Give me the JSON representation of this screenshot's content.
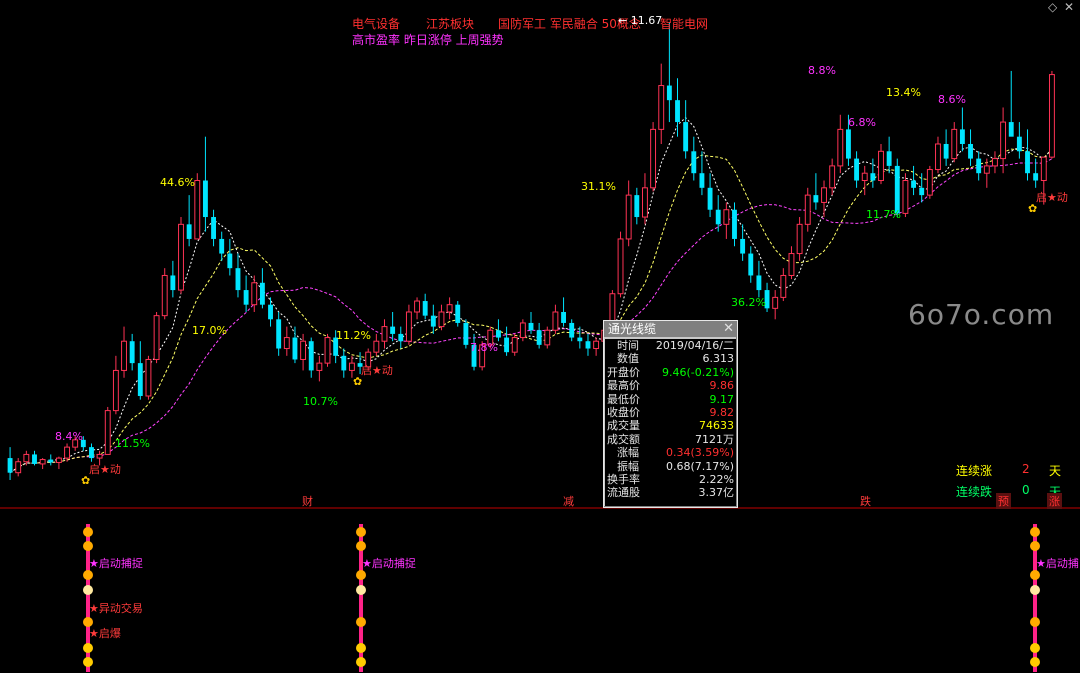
{
  "header": {
    "row1": [
      {
        "text": "电气设备",
        "color": "#ff3030"
      },
      {
        "text": "江苏板块",
        "color": "#ff3030"
      },
      {
        "text": "国防军工 军民融合 50概念",
        "color": "#ff3030"
      },
      {
        "text": "智能电网",
        "color": "#ff3030"
      }
    ],
    "row2": {
      "text": "高市盈率 昨日涨停 上周强势",
      "color": "#ff33ff"
    },
    "peak_price": "11.67"
  },
  "pct_labels": [
    {
      "text": "44.6%",
      "color": "#ffff00"
    },
    {
      "text": "17.0%",
      "color": "#ffff00"
    },
    {
      "text": "11.5%",
      "color": "#00ff00"
    },
    {
      "text": "8.4%",
      "color": "#ff33ff"
    },
    {
      "text": "10.7%",
      "color": "#00ff00"
    },
    {
      "text": "11.2%",
      "color": "#ffff00"
    },
    {
      "text": "7.8%",
      "color": "#ff33ff"
    },
    {
      "text": "31.1%",
      "color": "#ffff00"
    },
    {
      "text": "36.2%",
      "color": "#00ff00"
    },
    {
      "text": "8.8%",
      "color": "#ff33ff"
    },
    {
      "text": "6.8%",
      "color": "#ff33ff"
    },
    {
      "text": "11.7%",
      "color": "#00ff00"
    },
    {
      "text": "13.4%",
      "color": "#ffff00"
    },
    {
      "text": "8.6%",
      "color": "#ff33ff"
    }
  ],
  "start_labels": [
    "启★动",
    "启★动",
    "启★动"
  ],
  "axis_marks": [
    {
      "text": "财",
      "color": "#66aaff"
    },
    {
      "text": "减",
      "color": "#00ff66"
    },
    {
      "text": "跌",
      "color": "#00ff66"
    }
  ],
  "tooltip": {
    "title": "通光线缆",
    "close": "✕",
    "rows": [
      {
        "label": "时间",
        "value": "2019/04/16/二",
        "color": "#e6e6e6"
      },
      {
        "label": "数值",
        "value": "6.313",
        "color": "#e6e6e6"
      },
      {
        "label": "开盘价",
        "value": "9.46(-0.21%)",
        "color": "#00ff00"
      },
      {
        "label": "最高价",
        "value": "9.86",
        "color": "#ff3030"
      },
      {
        "label": "最低价",
        "value": "9.17",
        "color": "#00ff00"
      },
      {
        "label": "收盘价",
        "value": "9.82",
        "color": "#ff3030"
      },
      {
        "label": "成交量",
        "value": "74633",
        "color": "#ffff00"
      },
      {
        "label": "成交额",
        "value": "7121万",
        "color": "#e6e6e6"
      },
      {
        "label": "涨幅",
        "value": "0.34(3.59%)",
        "color": "#ff3030"
      },
      {
        "label": "振幅",
        "value": "0.68(7.17%)",
        "color": "#e6e6e6"
      },
      {
        "label": "换手率",
        "value": "2.22%",
        "color": "#e6e6e6"
      },
      {
        "label": "流通股",
        "value": "3.37亿",
        "color": "#e6e6e6"
      }
    ]
  },
  "streaks": {
    "up": {
      "label": "连续涨",
      "count": "2",
      "unit": "天"
    },
    "down": {
      "label": "连续跌",
      "count": "0",
      "unit": "天"
    },
    "pre": "预",
    "rise": "涨"
  },
  "signals": {
    "catch": "★启动捕捉",
    "catch_cut": "★启动捕",
    "abnormal": "★异动交易",
    "launch": "★启爆"
  },
  "watermark": "6o7o.com",
  "colors": {
    "up": "#ff3355",
    "down": "#00e5ff",
    "ma_fast": "#ffffff",
    "ma_mid": "#ffff66",
    "ma_slow": "#ff44ff",
    "divider": "#c00000",
    "signal_bar": "#ff2288"
  },
  "chart_data": {
    "type": "candlestick",
    "ohlc": [
      [
        5.7,
        5.85,
        5.4,
        5.5
      ],
      [
        5.5,
        5.7,
        5.45,
        5.65
      ],
      [
        5.65,
        5.8,
        5.6,
        5.75
      ],
      [
        5.75,
        5.8,
        5.6,
        5.62
      ],
      [
        5.62,
        5.7,
        5.55,
        5.68
      ],
      [
        5.68,
        5.75,
        5.6,
        5.64
      ],
      [
        5.64,
        5.72,
        5.55,
        5.7
      ],
      [
        5.7,
        5.9,
        5.65,
        5.85
      ],
      [
        5.85,
        6.0,
        5.8,
        5.95
      ],
      [
        5.95,
        6.0,
        5.8,
        5.85
      ],
      [
        5.85,
        5.9,
        5.65,
        5.7
      ],
      [
        5.7,
        5.8,
        5.6,
        5.75
      ],
      [
        5.75,
        6.4,
        5.75,
        6.35
      ],
      [
        6.35,
        7.1,
        6.3,
        6.9
      ],
      [
        6.9,
        7.5,
        6.8,
        7.3
      ],
      [
        7.3,
        7.4,
        6.9,
        7.0
      ],
      [
        7.0,
        7.3,
        6.5,
        6.55
      ],
      [
        6.55,
        7.1,
        6.5,
        7.05
      ],
      [
        7.05,
        7.7,
        7.0,
        7.65
      ],
      [
        7.65,
        8.3,
        7.6,
        8.2
      ],
      [
        8.2,
        8.4,
        7.9,
        8.0
      ],
      [
        8.0,
        9.0,
        7.95,
        8.9
      ],
      [
        8.9,
        9.3,
        8.6,
        8.7
      ],
      [
        8.7,
        9.6,
        8.7,
        9.5
      ],
      [
        9.5,
        10.1,
        8.8,
        9.0
      ],
      [
        9.0,
        9.1,
        8.6,
        8.7
      ],
      [
        8.7,
        8.8,
        8.4,
        8.5
      ],
      [
        8.5,
        8.7,
        8.2,
        8.3
      ],
      [
        8.3,
        8.5,
        7.9,
        8.0
      ],
      [
        8.0,
        8.2,
        7.7,
        7.8
      ],
      [
        7.8,
        8.2,
        7.7,
        8.1
      ],
      [
        8.1,
        8.3,
        7.75,
        7.8
      ],
      [
        7.8,
        7.9,
        7.5,
        7.6
      ],
      [
        7.6,
        7.7,
        7.1,
        7.2
      ],
      [
        7.2,
        7.5,
        7.1,
        7.35
      ],
      [
        7.35,
        7.5,
        7.0,
        7.05
      ],
      [
        7.05,
        7.4,
        6.9,
        7.3
      ],
      [
        7.3,
        7.35,
        6.8,
        6.9
      ],
      [
        6.9,
        7.1,
        6.75,
        7.0
      ],
      [
        7.0,
        7.4,
        6.95,
        7.35
      ],
      [
        7.35,
        7.45,
        7.0,
        7.1
      ],
      [
        7.1,
        7.2,
        6.8,
        6.9
      ],
      [
        6.9,
        7.1,
        6.8,
        7.0
      ],
      [
        7.0,
        7.15,
        6.85,
        6.95
      ],
      [
        6.95,
        7.2,
        6.9,
        7.15
      ],
      [
        7.15,
        7.4,
        7.1,
        7.3
      ],
      [
        7.3,
        7.6,
        7.2,
        7.5
      ],
      [
        7.5,
        7.7,
        7.3,
        7.4
      ],
      [
        7.4,
        7.5,
        7.2,
        7.3
      ],
      [
        7.3,
        7.8,
        7.25,
        7.7
      ],
      [
        7.7,
        7.9,
        7.6,
        7.85
      ],
      [
        7.85,
        7.95,
        7.6,
        7.65
      ],
      [
        7.65,
        7.8,
        7.4,
        7.5
      ],
      [
        7.5,
        7.8,
        7.45,
        7.7
      ],
      [
        7.7,
        7.9,
        7.6,
        7.8
      ],
      [
        7.8,
        7.85,
        7.5,
        7.55
      ],
      [
        7.55,
        7.6,
        7.2,
        7.25
      ],
      [
        7.25,
        7.4,
        6.9,
        6.95
      ],
      [
        6.95,
        7.3,
        6.9,
        7.25
      ],
      [
        7.25,
        7.5,
        7.2,
        7.45
      ],
      [
        7.45,
        7.6,
        7.3,
        7.35
      ],
      [
        7.35,
        7.5,
        7.1,
        7.15
      ],
      [
        7.15,
        7.4,
        7.1,
        7.35
      ],
      [
        7.35,
        7.6,
        7.3,
        7.55
      ],
      [
        7.55,
        7.7,
        7.4,
        7.45
      ],
      [
        7.45,
        7.55,
        7.2,
        7.25
      ],
      [
        7.25,
        7.5,
        7.2,
        7.45
      ],
      [
        7.45,
        7.8,
        7.4,
        7.7
      ],
      [
        7.7,
        7.9,
        7.5,
        7.55
      ],
      [
        7.55,
        7.6,
        7.3,
        7.35
      ],
      [
        7.35,
        7.5,
        7.2,
        7.3
      ],
      [
        7.3,
        7.4,
        7.1,
        7.2
      ],
      [
        7.2,
        7.35,
        7.1,
        7.3
      ],
      [
        7.3,
        7.5,
        7.25,
        7.45
      ],
      [
        7.45,
        8.0,
        7.45,
        7.95
      ],
      [
        7.95,
        8.8,
        7.9,
        8.7
      ],
      [
        8.7,
        9.5,
        8.6,
        9.3
      ],
      [
        9.3,
        9.4,
        8.9,
        9.0
      ],
      [
        9.0,
        9.6,
        8.9,
        9.4
      ],
      [
        9.4,
        10.3,
        9.35,
        10.2
      ],
      [
        10.2,
        11.1,
        10.0,
        10.8
      ],
      [
        10.8,
        11.67,
        10.3,
        10.6
      ],
      [
        10.6,
        10.9,
        10.1,
        10.3
      ],
      [
        10.3,
        10.6,
        9.8,
        9.9
      ],
      [
        9.9,
        10.1,
        9.5,
        9.6
      ],
      [
        9.6,
        9.9,
        9.3,
        9.4
      ],
      [
        9.4,
        9.6,
        9.0,
        9.1
      ],
      [
        9.1,
        9.3,
        8.8,
        8.9
      ],
      [
        8.9,
        9.2,
        8.7,
        9.1
      ],
      [
        9.1,
        9.2,
        8.6,
        8.7
      ],
      [
        8.7,
        8.9,
        8.4,
        8.5
      ],
      [
        8.5,
        8.6,
        8.1,
        8.2
      ],
      [
        8.2,
        8.4,
        7.9,
        8.0
      ],
      [
        8.0,
        8.1,
        7.7,
        7.75
      ],
      [
        7.75,
        8.0,
        7.6,
        7.9
      ],
      [
        7.9,
        8.3,
        7.85,
        8.2
      ],
      [
        8.2,
        8.6,
        8.15,
        8.5
      ],
      [
        8.5,
        9.0,
        8.4,
        8.9
      ],
      [
        8.9,
        9.4,
        8.8,
        9.3
      ],
      [
        9.3,
        9.6,
        9.1,
        9.2
      ],
      [
        9.2,
        9.5,
        9.0,
        9.4
      ],
      [
        9.4,
        9.8,
        9.3,
        9.7
      ],
      [
        9.7,
        10.4,
        9.6,
        10.2
      ],
      [
        10.2,
        10.4,
        9.7,
        9.8
      ],
      [
        9.8,
        9.9,
        9.4,
        9.5
      ],
      [
        9.5,
        9.7,
        9.3,
        9.6
      ],
      [
        9.6,
        9.8,
        9.4,
        9.5
      ],
      [
        9.5,
        10.0,
        9.45,
        9.9
      ],
      [
        9.9,
        10.1,
        9.6,
        9.7
      ],
      [
        9.7,
        9.8,
        9.0,
        9.05
      ],
      [
        9.05,
        9.6,
        9.0,
        9.5
      ],
      [
        9.5,
        9.7,
        9.3,
        9.4
      ],
      [
        9.4,
        9.6,
        9.2,
        9.3
      ],
      [
        9.3,
        9.7,
        9.25,
        9.65
      ],
      [
        9.65,
        10.1,
        9.6,
        10.0
      ],
      [
        10.0,
        10.2,
        9.7,
        9.8
      ],
      [
        9.8,
        10.3,
        9.75,
        10.2
      ],
      [
        10.2,
        10.5,
        9.9,
        10.0
      ],
      [
        10.0,
        10.2,
        9.7,
        9.8
      ],
      [
        9.8,
        9.9,
        9.5,
        9.6
      ],
      [
        9.6,
        9.8,
        9.4,
        9.7
      ],
      [
        9.7,
        9.9,
        9.6,
        9.8
      ],
      [
        9.8,
        10.5,
        9.6,
        10.3
      ],
      [
        10.3,
        11.0,
        10.2,
        10.1
      ],
      [
        10.1,
        10.3,
        9.8,
        9.9
      ],
      [
        9.9,
        10.2,
        9.5,
        9.6
      ],
      [
        9.6,
        9.8,
        9.4,
        9.5
      ],
      [
        9.5,
        9.8,
        9.17,
        9.82
      ],
      [
        9.82,
        11.0,
        9.8,
        10.95
      ]
    ]
  }
}
